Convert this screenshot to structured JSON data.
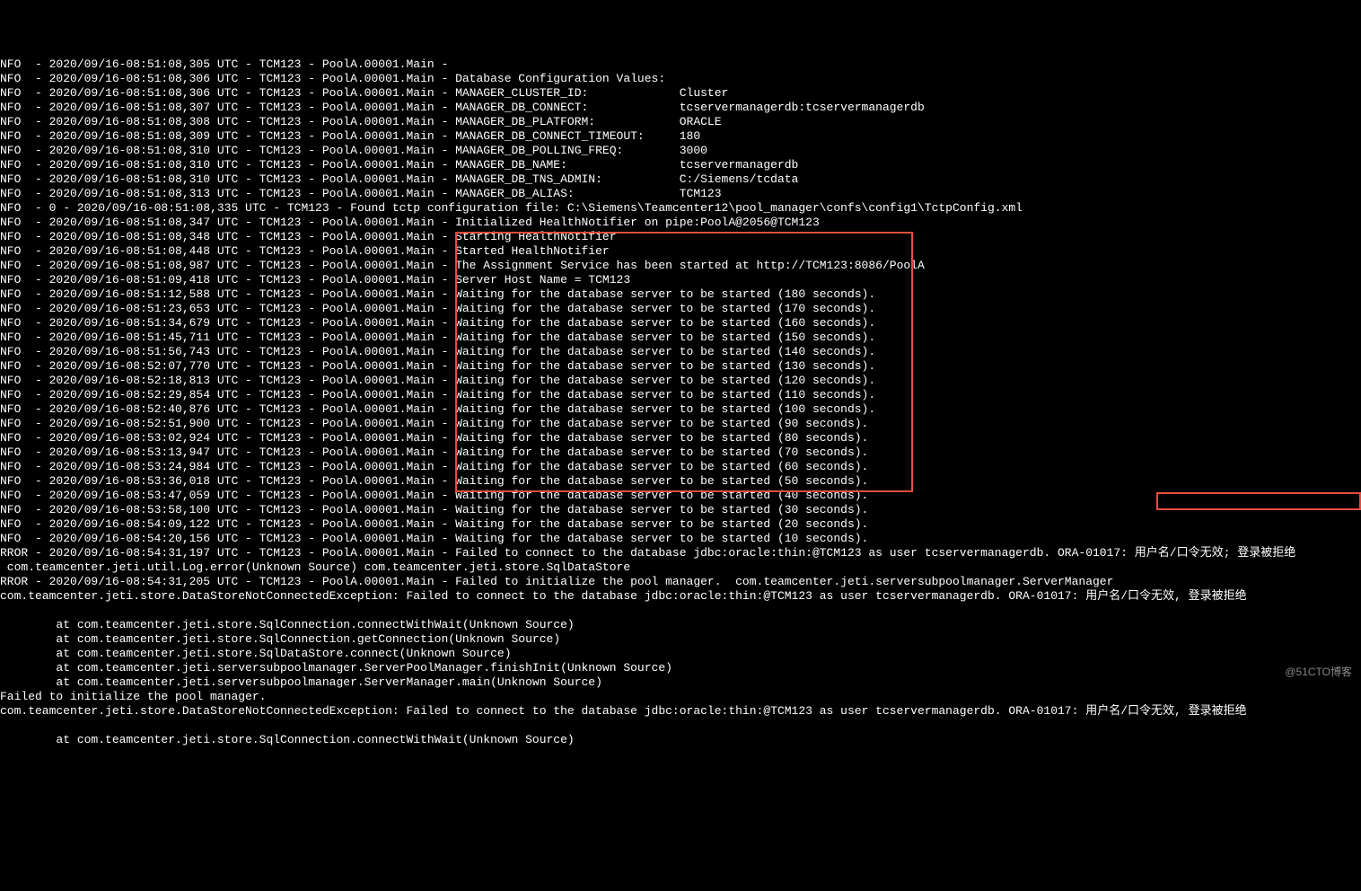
{
  "lines": [
    "NFO  - 2020/09/16-08:51:08,305 UTC - TCM123 - PoolA.00001.Main -",
    "NFO  - 2020/09/16-08:51:08,306 UTC - TCM123 - PoolA.00001.Main - Database Configuration Values:",
    "NFO  - 2020/09/16-08:51:08,306 UTC - TCM123 - PoolA.00001.Main - MANAGER_CLUSTER_ID:             Cluster",
    "NFO  - 2020/09/16-08:51:08,307 UTC - TCM123 - PoolA.00001.Main - MANAGER_DB_CONNECT:             tcservermanagerdb:tcservermanagerdb",
    "NFO  - 2020/09/16-08:51:08,308 UTC - TCM123 - PoolA.00001.Main - MANAGER_DB_PLATFORM:            ORACLE",
    "NFO  - 2020/09/16-08:51:08,309 UTC - TCM123 - PoolA.00001.Main - MANAGER_DB_CONNECT_TIMEOUT:     180",
    "NFO  - 2020/09/16-08:51:08,310 UTC - TCM123 - PoolA.00001.Main - MANAGER_DB_POLLING_FREQ:        3000",
    "NFO  - 2020/09/16-08:51:08,310 UTC - TCM123 - PoolA.00001.Main - MANAGER_DB_NAME:                tcservermanagerdb",
    "NFO  - 2020/09/16-08:51:08,310 UTC - TCM123 - PoolA.00001.Main - MANAGER_DB_TNS_ADMIN:           C:/Siemens/tcdata",
    "NFO  - 2020/09/16-08:51:08,313 UTC - TCM123 - PoolA.00001.Main - MANAGER_DB_ALIAS:               TCM123",
    "NFO  - 0 - 2020/09/16-08:51:08,335 UTC - TCM123 - Found tctp configuration file: C:\\Siemens\\Teamcenter12\\pool_manager\\confs\\config1\\TctpConfig.xml",
    "NFO  - 2020/09/16-08:51:08,347 UTC - TCM123 - PoolA.00001.Main - Initialized HealthNotifier on pipe:PoolA@2056@TCM123",
    "NFO  - 2020/09/16-08:51:08,348 UTC - TCM123 - PoolA.00001.Main - Starting HealthNotifier",
    "NFO  - 2020/09/16-08:51:08,448 UTC - TCM123 - PoolA.00001.Main - Started HealthNotifier",
    "NFO  - 2020/09/16-08:51:08,987 UTC - TCM123 - PoolA.00001.Main - The Assignment Service has been started at http://TCM123:8086/PoolA",
    "NFO  - 2020/09/16-08:51:09,418 UTC - TCM123 - PoolA.00001.Main - Server Host Name = TCM123",
    "NFO  - 2020/09/16-08:51:12,588 UTC - TCM123 - PoolA.00001.Main - Waiting for the database server to be started (180 seconds).",
    "NFO  - 2020/09/16-08:51:23,653 UTC - TCM123 - PoolA.00001.Main - Waiting for the database server to be started (170 seconds).",
    "NFO  - 2020/09/16-08:51:34,679 UTC - TCM123 - PoolA.00001.Main - Waiting for the database server to be started (160 seconds).",
    "NFO  - 2020/09/16-08:51:45,711 UTC - TCM123 - PoolA.00001.Main - Waiting for the database server to be started (150 seconds).",
    "NFO  - 2020/09/16-08:51:56,743 UTC - TCM123 - PoolA.00001.Main - Waiting for the database server to be started (140 seconds).",
    "NFO  - 2020/09/16-08:52:07,770 UTC - TCM123 - PoolA.00001.Main - Waiting for the database server to be started (130 seconds).",
    "NFO  - 2020/09/16-08:52:18,813 UTC - TCM123 - PoolA.00001.Main - Waiting for the database server to be started (120 seconds).",
    "NFO  - 2020/09/16-08:52:29,854 UTC - TCM123 - PoolA.00001.Main - Waiting for the database server to be started (110 seconds).",
    "NFO  - 2020/09/16-08:52:40,876 UTC - TCM123 - PoolA.00001.Main - Waiting for the database server to be started (100 seconds).",
    "NFO  - 2020/09/16-08:52:51,900 UTC - TCM123 - PoolA.00001.Main - Waiting for the database server to be started (90 seconds).",
    "NFO  - 2020/09/16-08:53:02,924 UTC - TCM123 - PoolA.00001.Main - Waiting for the database server to be started (80 seconds).",
    "NFO  - 2020/09/16-08:53:13,947 UTC - TCM123 - PoolA.00001.Main - Waiting for the database server to be started (70 seconds).",
    "NFO  - 2020/09/16-08:53:24,984 UTC - TCM123 - PoolA.00001.Main - Waiting for the database server to be started (60 seconds).",
    "NFO  - 2020/09/16-08:53:36,018 UTC - TCM123 - PoolA.00001.Main - Waiting for the database server to be started (50 seconds).",
    "NFO  - 2020/09/16-08:53:47,059 UTC - TCM123 - PoolA.00001.Main - Waiting for the database server to be started (40 seconds).",
    "NFO  - 2020/09/16-08:53:58,100 UTC - TCM123 - PoolA.00001.Main - Waiting for the database server to be started (30 seconds).",
    "NFO  - 2020/09/16-08:54:09,122 UTC - TCM123 - PoolA.00001.Main - Waiting for the database server to be started (20 seconds).",
    "NFO  - 2020/09/16-08:54:20,156 UTC - TCM123 - PoolA.00001.Main - Waiting for the database server to be started (10 seconds).",
    "RROR - 2020/09/16-08:54:31,197 UTC - TCM123 - PoolA.00001.Main - Failed to connect to the database jdbc:oracle:thin:@TCM123 as user tcservermanagerdb. ORA-01017: 用户名/口令无效; 登录被拒绝",
    " com.teamcenter.jeti.util.Log.error(Unknown Source) com.teamcenter.jeti.store.SqlDataStore",
    "RROR - 2020/09/16-08:54:31,205 UTC - TCM123 - PoolA.00001.Main - Failed to initialize the pool manager.  com.teamcenter.jeti.serversubpoolmanager.ServerManager",
    "com.teamcenter.jeti.store.DataStoreNotConnectedException: Failed to connect to the database jdbc:oracle:thin:@TCM123 as user tcservermanagerdb. ORA-01017: 用户名/口令无效, 登录被拒绝",
    "",
    "        at com.teamcenter.jeti.store.SqlConnection.connectWithWait(Unknown Source)",
    "        at com.teamcenter.jeti.store.SqlConnection.getConnection(Unknown Source)",
    "        at com.teamcenter.jeti.store.SqlDataStore.connect(Unknown Source)",
    "        at com.teamcenter.jeti.serversubpoolmanager.ServerPoolManager.finishInit(Unknown Source)",
    "        at com.teamcenter.jeti.serversubpoolmanager.ServerManager.main(Unknown Source)",
    "Failed to initialize the pool manager.",
    "com.teamcenter.jeti.store.DataStoreNotConnectedException: Failed to connect to the database jdbc:oracle:thin:@TCM123 as user tcservermanagerdb. ORA-01017: 用户名/口令无效, 登录被拒绝",
    "",
    "        at com.teamcenter.jeti.store.SqlConnection.connectWithWait(Unknown Source)"
  ],
  "watermark": "@51CTO博客"
}
